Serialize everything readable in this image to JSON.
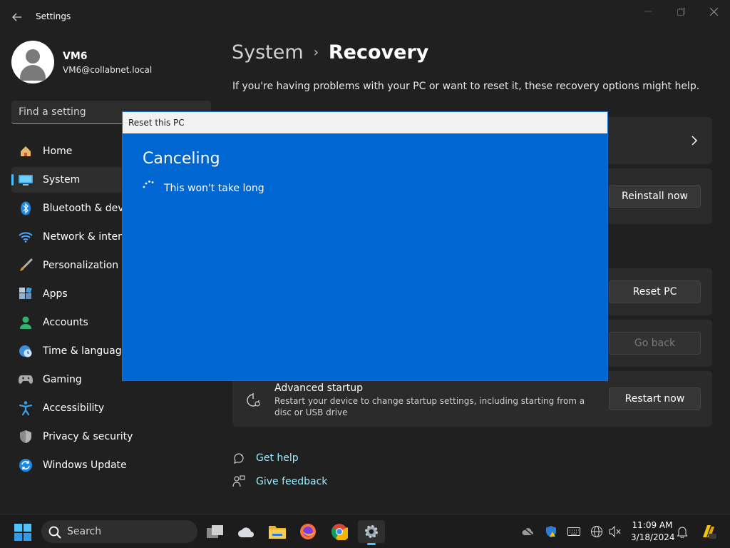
{
  "window": {
    "app_title": "Settings",
    "icons": {
      "back": "back-arrow-icon",
      "minimize": "minimize-icon",
      "maximize": "restore-icon",
      "close": "close-icon"
    }
  },
  "profile": {
    "name": "VM6",
    "email": "VM6@collabnet.local"
  },
  "search": {
    "placeholder": "Find a setting"
  },
  "nav": {
    "items": [
      {
        "label": "Home",
        "icon": "home-icon",
        "selected": false
      },
      {
        "label": "System",
        "icon": "monitor-icon",
        "selected": true
      },
      {
        "label": "Bluetooth & devices",
        "icon": "bluetooth-icon",
        "selected": false
      },
      {
        "label": "Network & internet",
        "icon": "wifi-icon",
        "selected": false
      },
      {
        "label": "Personalization",
        "icon": "brush-icon",
        "selected": false
      },
      {
        "label": "Apps",
        "icon": "apps-icon",
        "selected": false
      },
      {
        "label": "Accounts",
        "icon": "person-icon",
        "selected": false
      },
      {
        "label": "Time & language",
        "icon": "globe-clock-icon",
        "selected": false
      },
      {
        "label": "Gaming",
        "icon": "gamepad-icon",
        "selected": false
      },
      {
        "label": "Accessibility",
        "icon": "accessibility-icon",
        "selected": false
      },
      {
        "label": "Privacy & security",
        "icon": "shield-icon",
        "selected": false
      },
      {
        "label": "Windows Update",
        "icon": "update-icon",
        "selected": false
      }
    ]
  },
  "main": {
    "breadcrumb_parent": "System",
    "breadcrumb_sep": "›",
    "breadcrumb_current": "Recovery",
    "subtitle": "If you're having problems with your PC or want to reset it, these recovery options might help.",
    "buttons": {
      "reinstall": "Reinstall now",
      "reset": "Reset PC",
      "goback": "Go back",
      "restart": "Restart now"
    },
    "advanced_startup": {
      "title": "Advanced startup",
      "description": "Restart your device to change startup settings, including starting from a disc or USB drive"
    },
    "links": {
      "help": "Get help",
      "feedback": "Give feedback"
    }
  },
  "dialog": {
    "title": "Reset this PC",
    "heading": "Canceling",
    "message": "This won't take long"
  },
  "taskbar": {
    "search_label": "Search",
    "apps": [
      "task-view-icon",
      "weather-icon",
      "file-explorer-icon",
      "firefox-icon",
      "chrome-icon",
      "settings-icon"
    ],
    "tray": [
      "cloud-offline-icon",
      "security-icon",
      "keyboard-icon",
      "language-icon",
      "volume-muted-icon",
      "notifications-icon",
      "copilot-icon"
    ],
    "time": "11:09 AM",
    "date": "3/18/2024"
  },
  "colors": {
    "accent": "#4cc2ff",
    "dialog_blue": "#0067d2",
    "link": "#99ebff"
  }
}
